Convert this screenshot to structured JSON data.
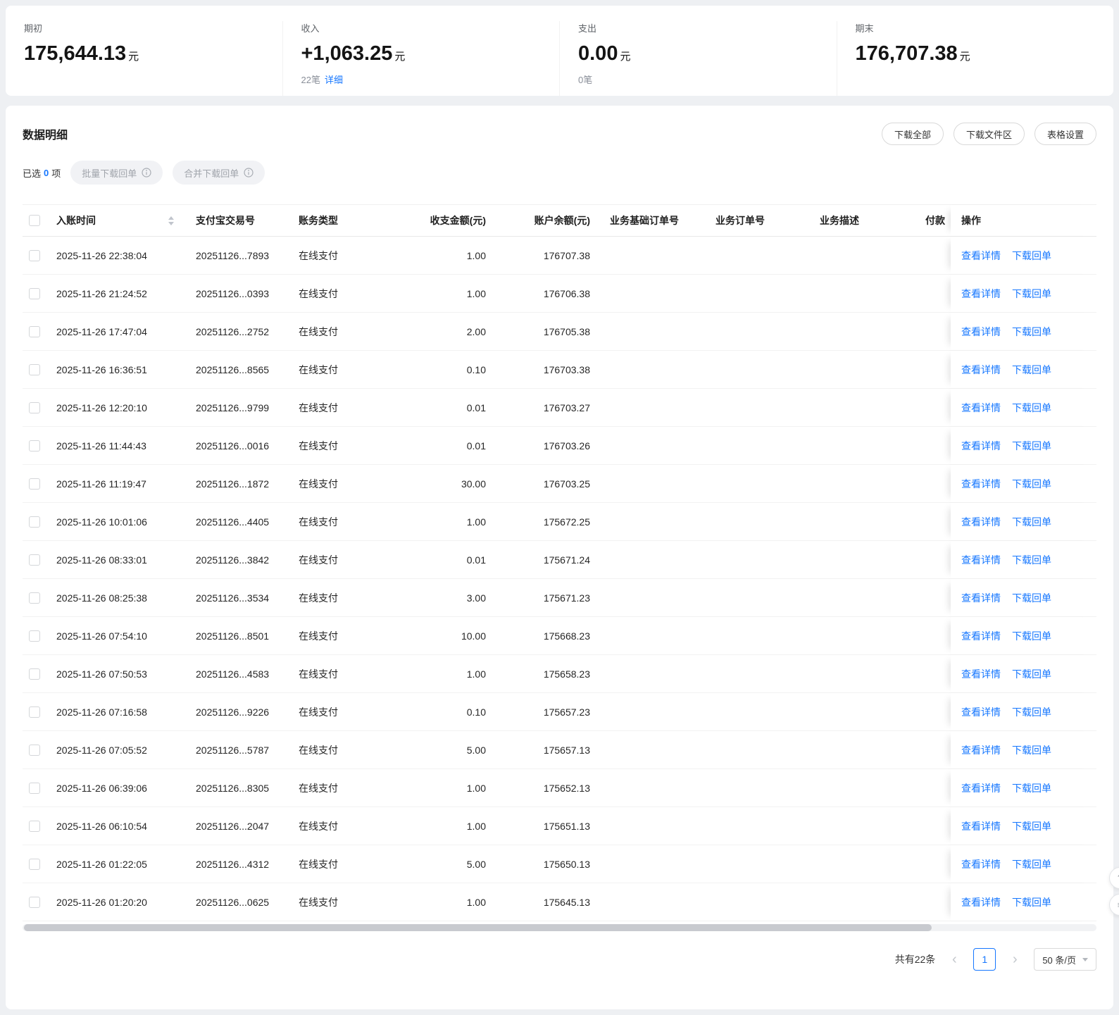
{
  "colors": {
    "link_blue": "#1677ff"
  },
  "summary": {
    "beginning": {
      "label": "期初",
      "value": "175,644.13",
      "unit": "元"
    },
    "income": {
      "label": "收入",
      "value": "+1,063.25",
      "unit": "元",
      "count": "22笔",
      "detail_link": "详细"
    },
    "expense": {
      "label": "支出",
      "value": "0.00",
      "unit": "元",
      "count": "0笔"
    },
    "ending": {
      "label": "期末",
      "value": "176,707.38",
      "unit": "元"
    }
  },
  "panel": {
    "title": "数据明细",
    "download_all": "下载全部",
    "download_zone": "下载文件区",
    "table_settings": "表格设置"
  },
  "toolbar": {
    "selected_prefix": "已选",
    "selected_count": "0",
    "selected_suffix": "项",
    "batch_download": "批量下载回单",
    "merge_download": "合并下载回单"
  },
  "table": {
    "columns": [
      "入账时间",
      "支付宝交易号",
      "账务类型",
      "收支金额(元)",
      "账户余额(元)",
      "业务基础订单号",
      "业务订单号",
      "业务描述",
      "付款",
      "操作"
    ],
    "row_actions": [
      "查看详情",
      "下载回单"
    ],
    "rows": [
      {
        "time": "2025-11-26 22:38:04",
        "txn": "20251126...7893",
        "type": "在线支付",
        "amount": "1.00",
        "balance": "176707.38"
      },
      {
        "time": "2025-11-26 21:24:52",
        "txn": "20251126...0393",
        "type": "在线支付",
        "amount": "1.00",
        "balance": "176706.38"
      },
      {
        "time": "2025-11-26 17:47:04",
        "txn": "20251126...2752",
        "type": "在线支付",
        "amount": "2.00",
        "balance": "176705.38"
      },
      {
        "time": "2025-11-26 16:36:51",
        "txn": "20251126...8565",
        "type": "在线支付",
        "amount": "0.10",
        "balance": "176703.38"
      },
      {
        "time": "2025-11-26 12:20:10",
        "txn": "20251126...9799",
        "type": "在线支付",
        "amount": "0.01",
        "balance": "176703.27"
      },
      {
        "time": "2025-11-26 11:44:43",
        "txn": "20251126...0016",
        "type": "在线支付",
        "amount": "0.01",
        "balance": "176703.26"
      },
      {
        "time": "2025-11-26 11:19:47",
        "txn": "20251126...1872",
        "type": "在线支付",
        "amount": "30.00",
        "balance": "176703.25"
      },
      {
        "time": "2025-11-26 10:01:06",
        "txn": "20251126...4405",
        "type": "在线支付",
        "amount": "1.00",
        "balance": "175672.25"
      },
      {
        "time": "2025-11-26 08:33:01",
        "txn": "20251126...3842",
        "type": "在线支付",
        "amount": "0.01",
        "balance": "175671.24"
      },
      {
        "time": "2025-11-26 08:25:38",
        "txn": "20251126...3534",
        "type": "在线支付",
        "amount": "3.00",
        "balance": "175671.23"
      },
      {
        "time": "2025-11-26 07:54:10",
        "txn": "20251126...8501",
        "type": "在线支付",
        "amount": "10.00",
        "balance": "175668.23"
      },
      {
        "time": "2025-11-26 07:50:53",
        "txn": "20251126...4583",
        "type": "在线支付",
        "amount": "1.00",
        "balance": "175658.23"
      },
      {
        "time": "2025-11-26 07:16:58",
        "txn": "20251126...9226",
        "type": "在线支付",
        "amount": "0.10",
        "balance": "175657.23"
      },
      {
        "time": "2025-11-26 07:05:52",
        "txn": "20251126...5787",
        "type": "在线支付",
        "amount": "5.00",
        "balance": "175657.13"
      },
      {
        "time": "2025-11-26 06:39:06",
        "txn": "20251126...8305",
        "type": "在线支付",
        "amount": "1.00",
        "balance": "175652.13"
      },
      {
        "time": "2025-11-26 06:10:54",
        "txn": "20251126...2047",
        "type": "在线支付",
        "amount": "1.00",
        "balance": "175651.13"
      },
      {
        "time": "2025-11-26 01:22:05",
        "txn": "20251126...4312",
        "type": "在线支付",
        "amount": "5.00",
        "balance": "175650.13"
      },
      {
        "time": "2025-11-26 01:20:20",
        "txn": "20251126...0625",
        "type": "在线支付",
        "amount": "1.00",
        "balance": "175645.13"
      }
    ]
  },
  "pagination": {
    "total_text": "共有22条",
    "prev_icon": "‹",
    "next_icon": "›",
    "current_page": "1",
    "page_size": "50 条/页"
  }
}
